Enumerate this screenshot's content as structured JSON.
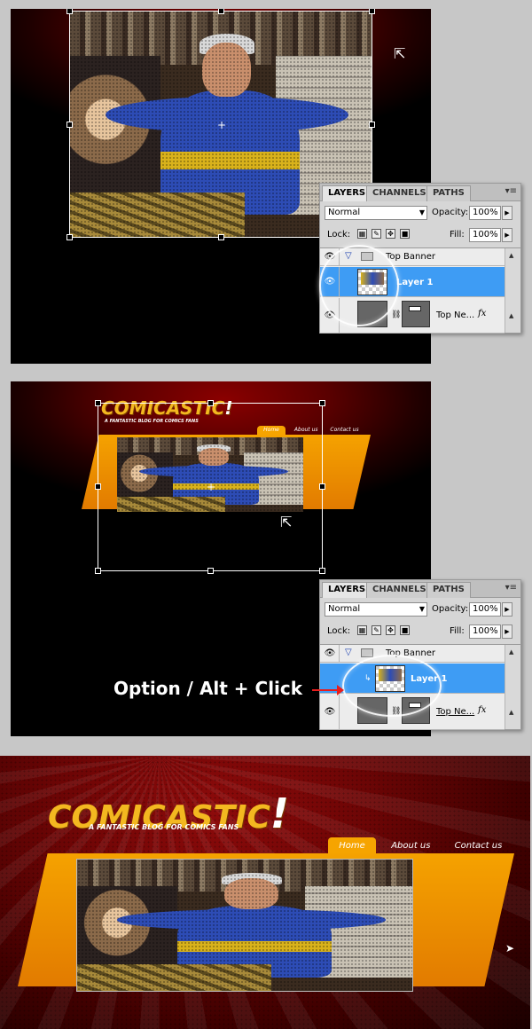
{
  "panel": {
    "tabs": [
      "LAYERS",
      "CHANNELS",
      "PATHS"
    ],
    "blend_mode": "Normal",
    "opacity_label": "Opacity:",
    "opacity_value": "100%",
    "lock_label": "Lock:",
    "fill_label": "Fill:",
    "fill_value": "100%",
    "layers": [
      "Top Banner",
      "Layer 1",
      "Top Ne..."
    ],
    "fx": "fx"
  },
  "annotation": "Option / Alt  + Click",
  "site": {
    "logo": "COMICASTIC",
    "bang": "!",
    "tagline": "A FANTASTIC BLOG FOR COMICS FANS",
    "nav": [
      "Home",
      "About us",
      "Contact us"
    ]
  },
  "colors": {
    "accent_orange": "#f5a200",
    "selection_blue": "#3e9cf4",
    "arrow_red": "#e81c1c"
  }
}
